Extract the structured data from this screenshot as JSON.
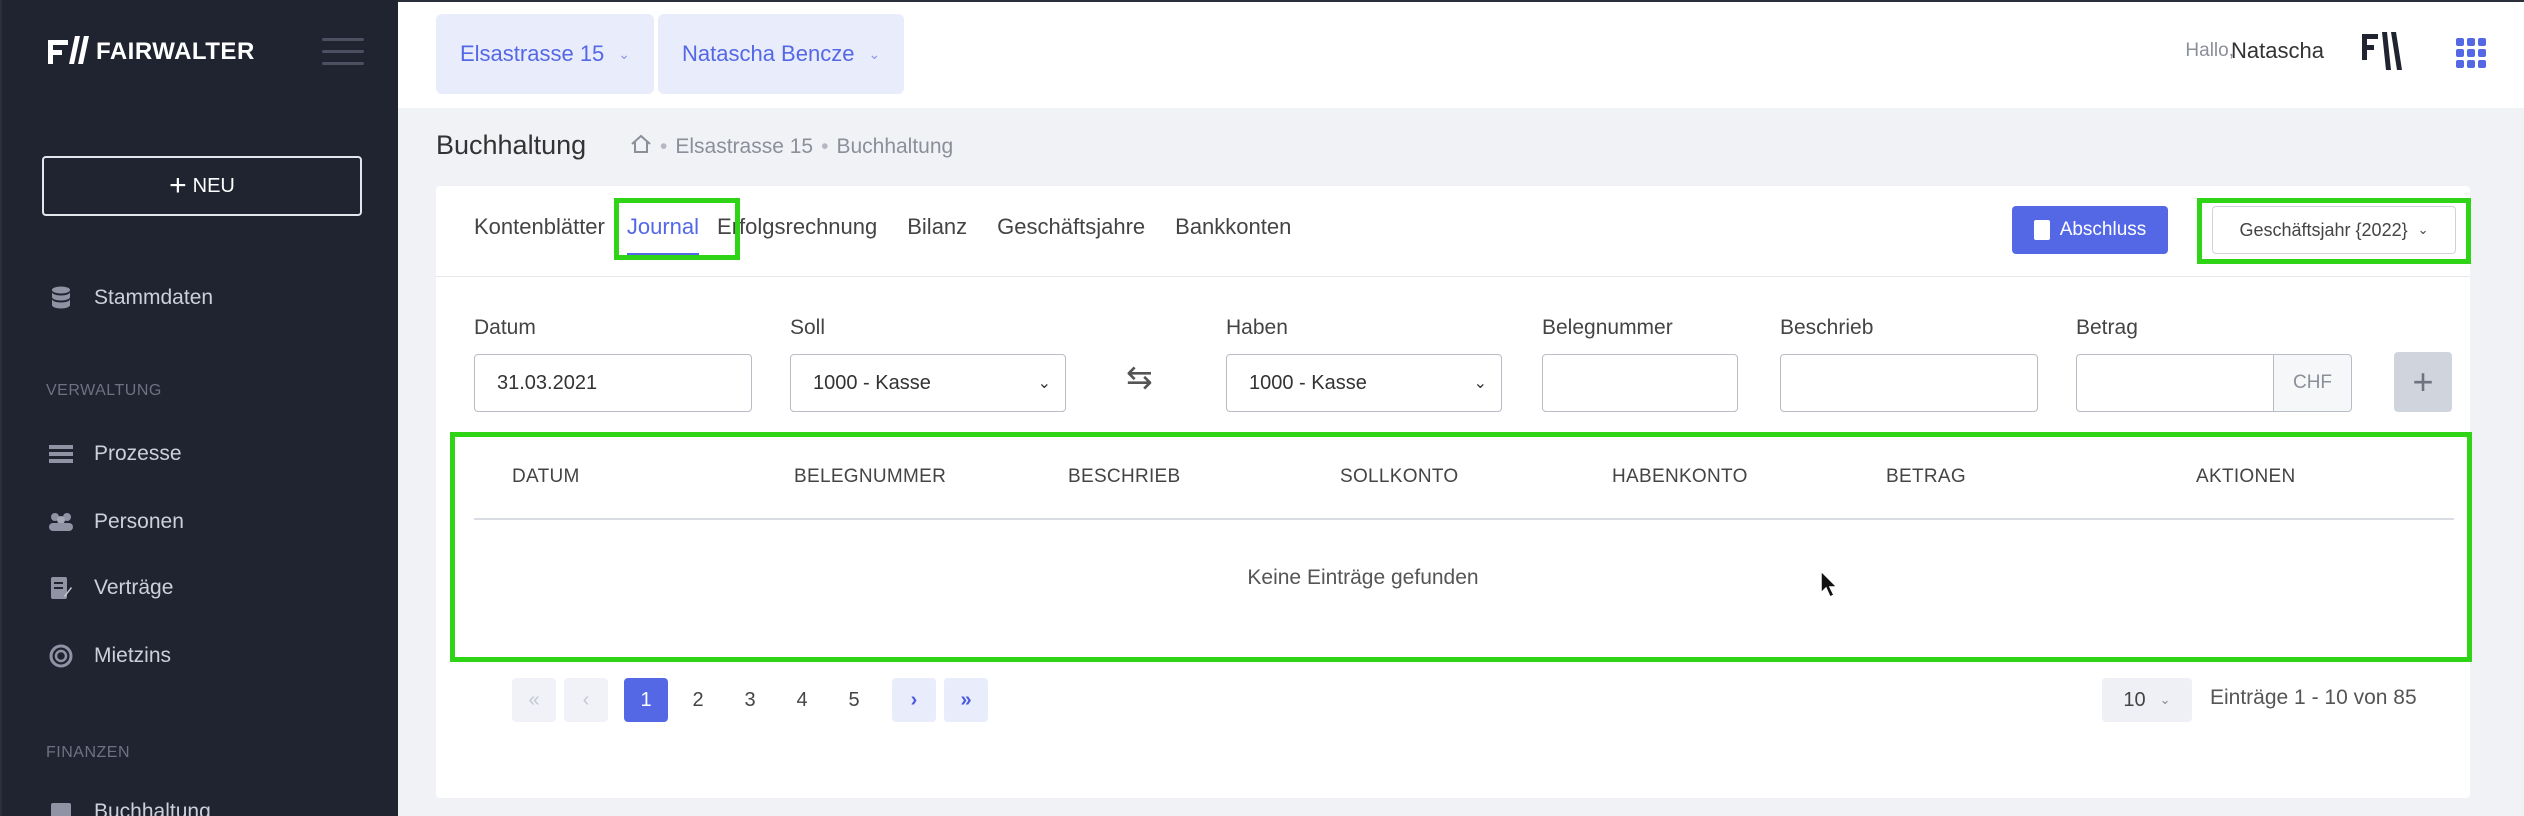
{
  "sidebar": {
    "logo_text": "FAIRWALTER",
    "new_button": "NEU",
    "items": [
      {
        "label": "Stammdaten",
        "icon": "database-icon"
      },
      {
        "label": "Prozesse",
        "icon": "list-icon"
      },
      {
        "label": "Personen",
        "icon": "people-icon"
      },
      {
        "label": "Verträge",
        "icon": "contract-icon"
      },
      {
        "label": "Mietzins",
        "icon": "coin-icon"
      },
      {
        "label": "Buchhaltung",
        "icon": "ledger-icon"
      }
    ],
    "sections": {
      "verwaltung": "VERWALTUNG",
      "finanzen": "FINANZEN"
    }
  },
  "header": {
    "property_select": "Elsastrasse 15",
    "person_select": "Natascha Bencze",
    "greeting": "Hallo,",
    "user_name": "Natascha"
  },
  "page": {
    "title": "Buchhaltung",
    "breadcrumb": [
      "Elsastrasse 15",
      "Buchhaltung"
    ]
  },
  "tabs": [
    "Kontenblätter",
    "Journal",
    "Erfolgsrechnung",
    "Bilanz",
    "Geschäftsjahre",
    "Bankkonten"
  ],
  "active_tab": "Journal",
  "actions": {
    "abschluss": "Abschluss",
    "fiscal_year": "Geschäftsjahr {2022}"
  },
  "form": {
    "datum_label": "Datum",
    "datum_value": "31.03.2021",
    "soll_label": "Soll",
    "soll_value": "1000 - Kasse",
    "haben_label": "Haben",
    "haben_value": "1000 - Kasse",
    "belegnummer_label": "Belegnummer",
    "belegnummer_value": "",
    "beschrieb_label": "Beschrieb",
    "beschrieb_value": "",
    "betrag_label": "Betrag",
    "betrag_value": "",
    "currency": "CHF"
  },
  "table": {
    "columns": [
      "DATUM",
      "BELEGNUMMER",
      "BESCHRIEB",
      "SOLLKONTO",
      "HABENKONTO",
      "BETRAG",
      "AKTIONEN"
    ],
    "empty_text": "Keine Einträge gefunden"
  },
  "pagination": {
    "first": "«",
    "prev": "‹",
    "pages": [
      "1",
      "2",
      "3",
      "4",
      "5"
    ],
    "current": "1",
    "next": "›",
    "last": "»",
    "per_page": "10",
    "summary": "Einträge 1 - 10 von 85"
  },
  "colors": {
    "accent": "#5468e6",
    "sidebar_bg": "#1f2430",
    "highlight": "#2fd416"
  }
}
